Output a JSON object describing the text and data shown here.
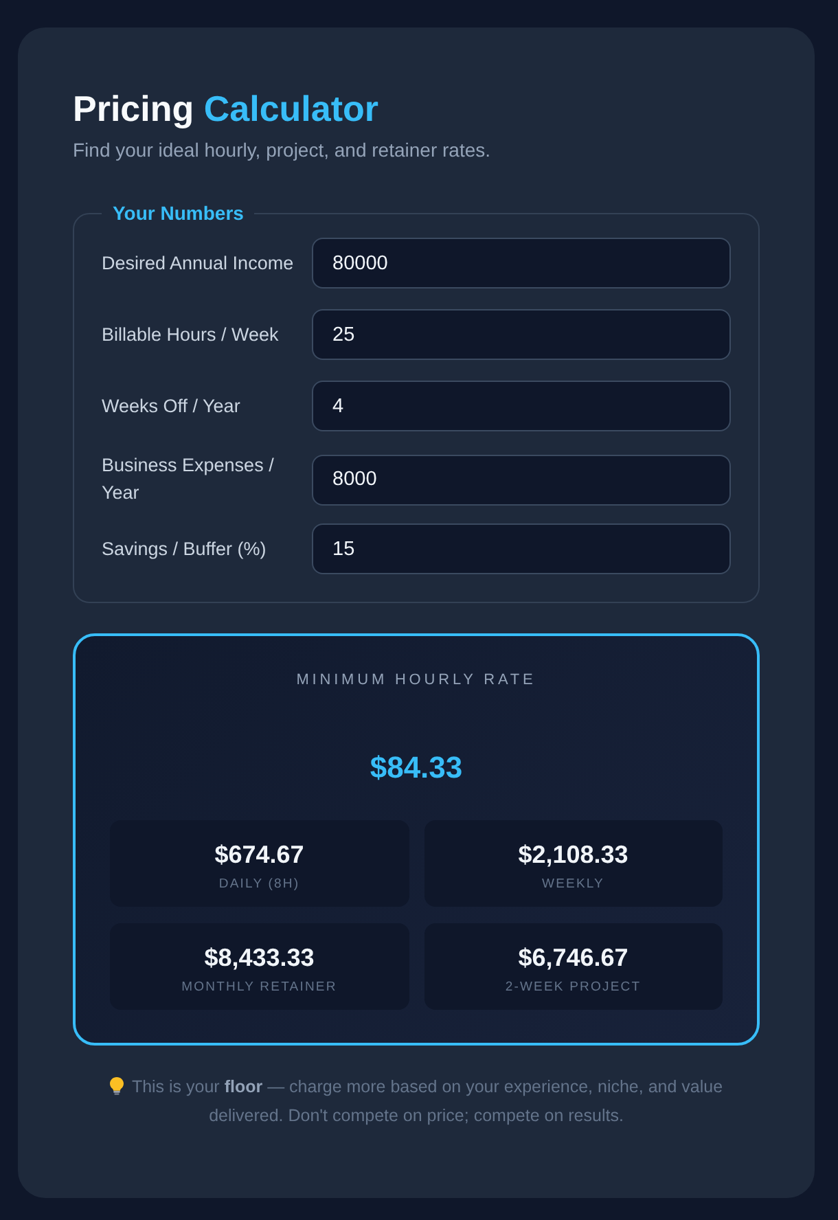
{
  "title": {
    "parts": [
      {
        "text": "Pricing",
        "accent": false
      },
      {
        "text": "Calculator",
        "accent": true
      }
    ]
  },
  "subtitle": "Find your ideal hourly, project, and retainer rates.",
  "inputs_group": {
    "legend": "Your Numbers",
    "fields": [
      {
        "label": "Desired Annual Income",
        "value": "80000"
      },
      {
        "label": "Billable Hours / Week",
        "value": "25"
      },
      {
        "label": "Weeks Off / Year",
        "value": "4"
      },
      {
        "label": "Business Expenses / Year",
        "value": "8000"
      },
      {
        "label": "Savings / Buffer (%)",
        "value": "15"
      }
    ]
  },
  "result": {
    "heading": "MINIMUM HOURLY RATE",
    "rate": "$84.33",
    "breakdown": [
      {
        "value": "$674.67",
        "label": "DAILY (8H)"
      },
      {
        "value": "$2,108.33",
        "label": "WEEKLY"
      },
      {
        "value": "$8,433.33",
        "label": "MONTHLY RETAINER"
      },
      {
        "value": "$6,746.67",
        "label": "2-WEEK PROJECT"
      }
    ]
  },
  "note": "This is your **floor** — charge more based on your experience, niche, and value delivered. Don't compete on price; compete on results."
}
